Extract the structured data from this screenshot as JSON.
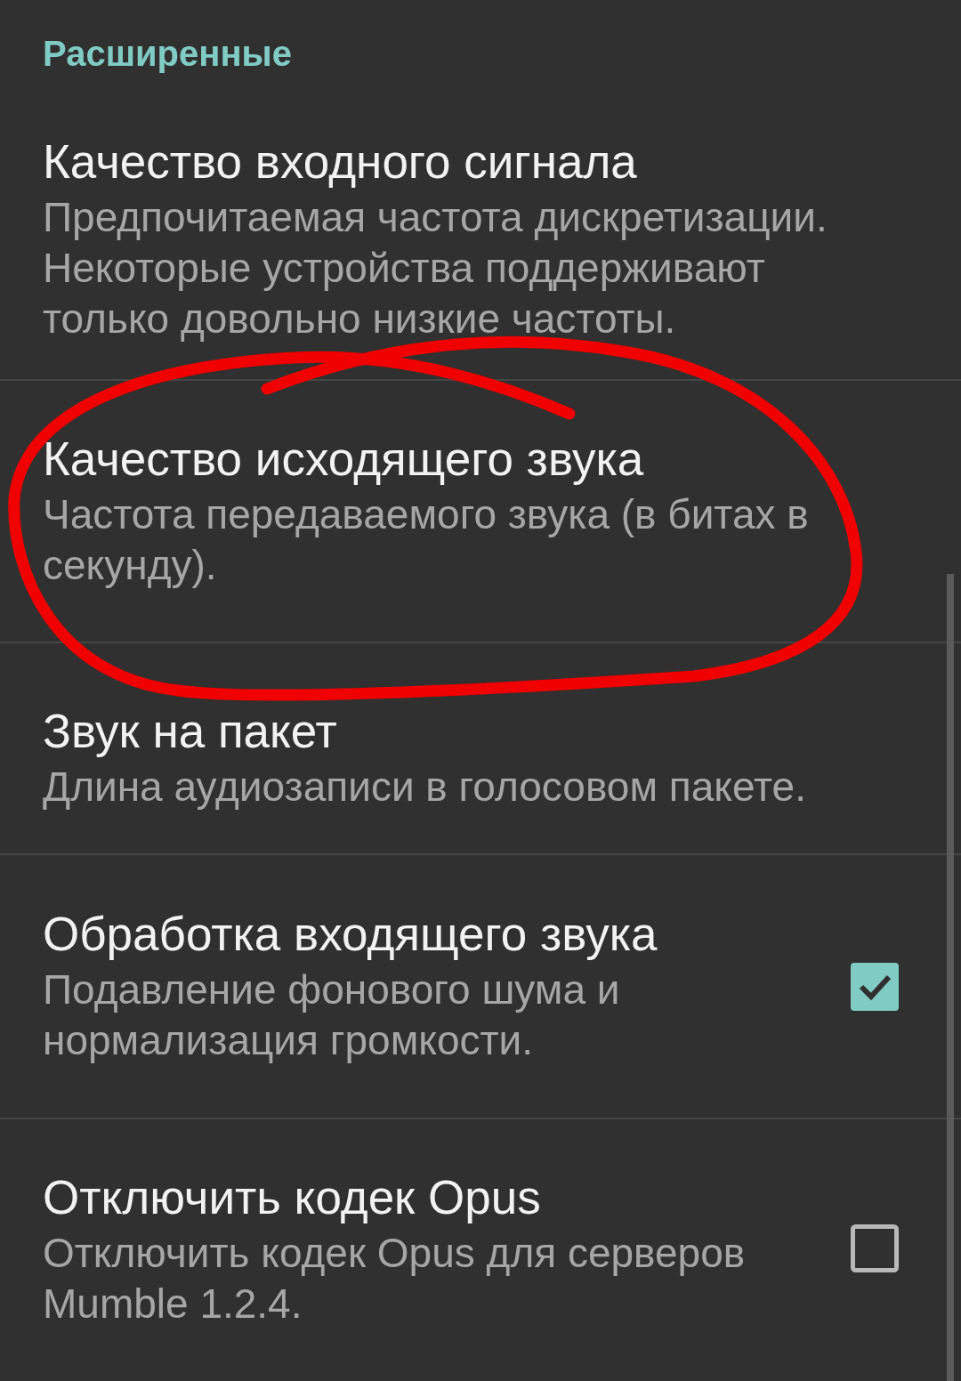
{
  "section_header": "Расширенные",
  "items": [
    {
      "kind": "plain",
      "title": "Качество входного сигнала",
      "summary": "Предпочитаемая частота дискретизации. Некоторые устройства поддерживают только довольно низкие частоты."
    },
    {
      "kind": "plain",
      "title": "Качество исходящего звука",
      "summary": "Частота передаваемого звука (в битах в секунду)."
    },
    {
      "kind": "plain",
      "title": "Звук на пакет",
      "summary": "Длина аудиозаписи в голосовом пакете."
    },
    {
      "kind": "checkbox",
      "title": "Обработка входящего звука",
      "summary": "Подавление фонового шума и нормализация громкости.",
      "checked": true
    },
    {
      "kind": "checkbox",
      "title": "Отключить кодек Opus",
      "summary": "Отключить кодек Opus для серверов Mumble 1.2.4.",
      "checked": false
    }
  ]
}
